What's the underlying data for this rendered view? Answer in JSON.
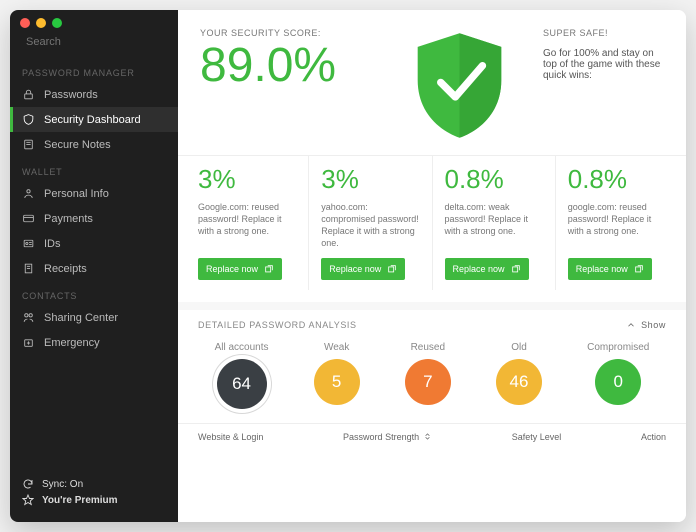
{
  "search": {
    "placeholder": "Search"
  },
  "sidebar": {
    "sections": [
      {
        "label": "PASSWORD MANAGER",
        "items": [
          {
            "label": "Passwords",
            "icon": "lock-icon",
            "active": false
          },
          {
            "label": "Security Dashboard",
            "icon": "shield-icon",
            "active": true
          },
          {
            "label": "Secure Notes",
            "icon": "note-icon",
            "active": false
          }
        ]
      },
      {
        "label": "WALLET",
        "items": [
          {
            "label": "Personal Info",
            "icon": "person-icon"
          },
          {
            "label": "Payments",
            "icon": "card-icon"
          },
          {
            "label": "IDs",
            "icon": "id-icon"
          },
          {
            "label": "Receipts",
            "icon": "receipt-icon"
          }
        ]
      },
      {
        "label": "CONTACTS",
        "items": [
          {
            "label": "Sharing Center",
            "icon": "share-icon"
          },
          {
            "label": "Emergency",
            "icon": "emergency-icon"
          }
        ]
      }
    ],
    "sync_label": "Sync: On",
    "premium_label": "You're Premium"
  },
  "score": {
    "label": "YOUR SECURITY SCORE:",
    "value": "89.0%",
    "safe_label": "SUPER SAFE!",
    "safe_text": "Go for 100% and stay on top of the game with these quick wins:"
  },
  "cards": [
    {
      "percent": "3%",
      "desc": "Google.com: reused password! Replace it with a strong one.",
      "button": "Replace now"
    },
    {
      "percent": "3%",
      "desc": "yahoo.com: compromised password! Replace it with a strong one.",
      "button": "Replace now"
    },
    {
      "percent": "0.8%",
      "desc": "delta.com: weak password! Replace it with a strong one.",
      "button": "Replace now"
    },
    {
      "percent": "0.8%",
      "desc": "google.com: reused password! Replace it with a strong one.",
      "button": "Replace now"
    }
  ],
  "analysis": {
    "title": "DETAILED PASSWORD ANALYSIS",
    "show": "Show",
    "bubbles": [
      {
        "label": "All accounts",
        "value": "64",
        "class": "all"
      },
      {
        "label": "Weak",
        "value": "5",
        "class": "weak"
      },
      {
        "label": "Reused",
        "value": "7",
        "class": "reused"
      },
      {
        "label": "Old",
        "value": "46",
        "class": "old"
      },
      {
        "label": "Compromised",
        "value": "0",
        "class": "comp"
      }
    ],
    "table_head": [
      "Website & Login",
      "Password Strength",
      "Safety Level",
      "Action"
    ]
  },
  "colors": {
    "accent": "#3fb93f"
  },
  "chart_data": {
    "type": "table",
    "title": "Detailed Password Analysis",
    "categories": [
      "All accounts",
      "Weak",
      "Reused",
      "Old",
      "Compromised"
    ],
    "values": [
      64,
      5,
      7,
      46,
      0
    ]
  }
}
